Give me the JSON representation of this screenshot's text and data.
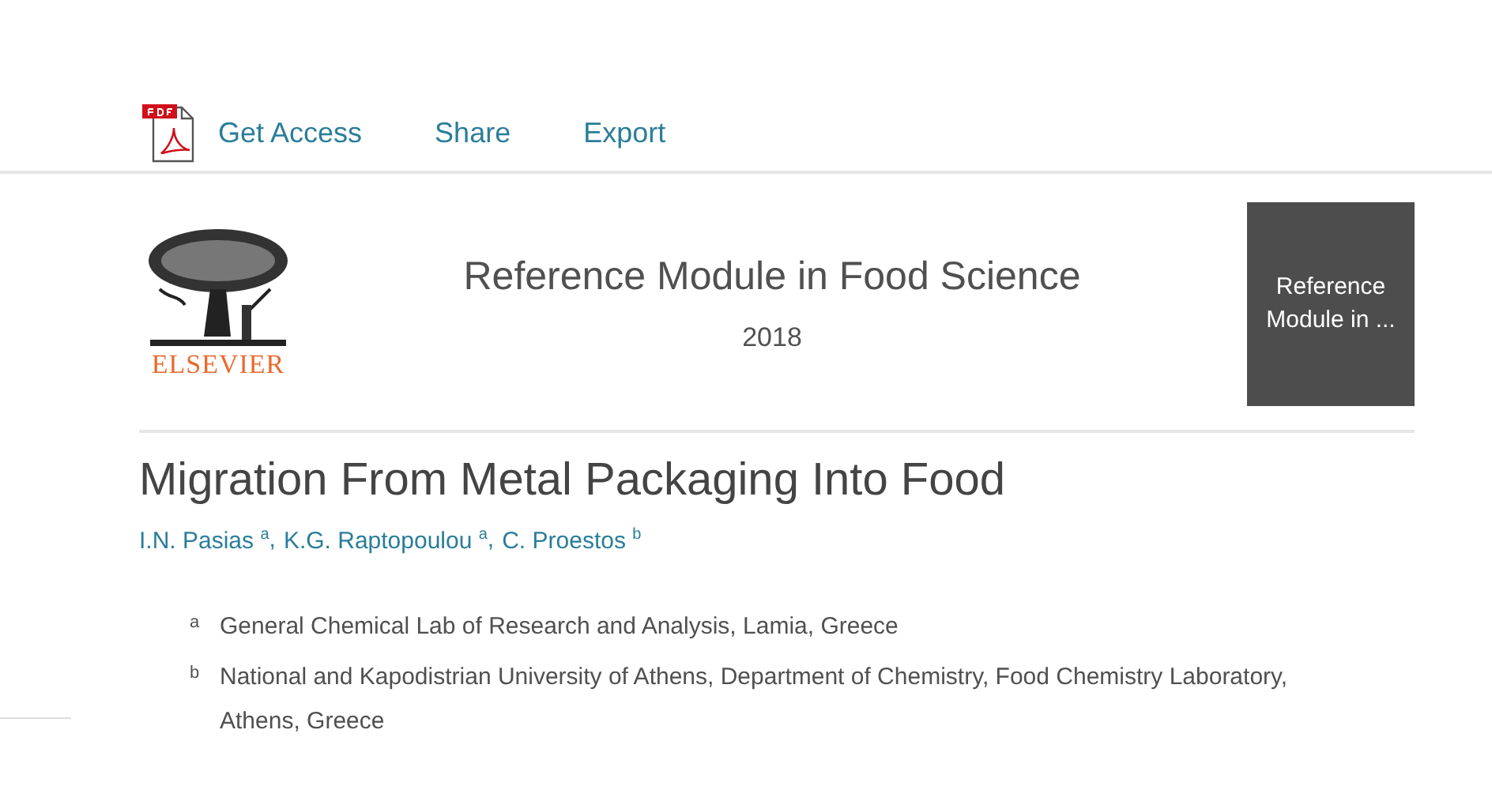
{
  "toolbar": {
    "actions": [
      {
        "kind": "pdf",
        "label": "Get Access"
      },
      {
        "kind": "link",
        "label": "Share"
      },
      {
        "kind": "link",
        "label": "Export"
      }
    ]
  },
  "publication": {
    "publisher": "ELSEVIER",
    "title": "Reference Module in Food Science",
    "year": "2018",
    "cover_text": "Reference Module in ..."
  },
  "article": {
    "title": "Migration From Metal Packaging Into Food",
    "author_separator": ",",
    "authors": [
      "I.N. Pasias $^{a}$",
      "K.G. Raptopoulou $^{a}$",
      "C. Proestos $^{b}$"
    ],
    "affiliations": [
      {
        "label": "a",
        "text": "General Chemical Lab of Research and Analysis, Lamia, Greece"
      },
      {
        "label": "b",
        "text": "National and Kapodistrian University of Athens, Department of Chemistry, Food Chemistry Laboratory, Athens, Greece"
      }
    ]
  }
}
